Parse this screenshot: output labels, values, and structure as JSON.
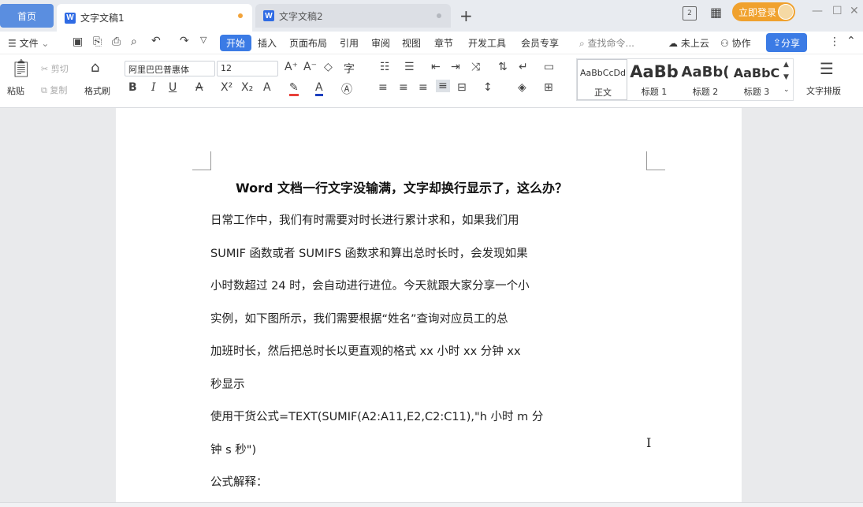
{
  "titlebar": {
    "home_tab": "首页",
    "tabs": [
      {
        "label": "文字文稿1",
        "icon": "W"
      },
      {
        "label": "文字文稿2",
        "icon": "W"
      }
    ],
    "add_tab": "+",
    "login_label": "立即登录",
    "window_controls": {
      "minimize": "—",
      "maximize": "☐",
      "close": "✕"
    }
  },
  "menubar": {
    "file": "文件",
    "items": [
      "开始",
      "插入",
      "页面布局",
      "引用",
      "审阅",
      "视图",
      "章节",
      "开发工具",
      "会员专享"
    ],
    "search_placeholder": "查找命令...",
    "cloud": "未上云",
    "collab": "协作",
    "share": "分享"
  },
  "ribbon": {
    "paste": "粘贴",
    "cut": "剪切",
    "copy": "复制",
    "format_painter": "格式刷",
    "font_name": "阿里巴巴普惠体",
    "font_size": "12",
    "bold": "B",
    "italic": "I",
    "underline": "U",
    "styles": [
      {
        "sample": "AaBbCcDd",
        "label": "正文"
      },
      {
        "sample": "AaBb",
        "label": "标题 1"
      },
      {
        "sample": "AaBb(",
        "label": "标题 2"
      },
      {
        "sample": "AaBbC",
        "label": "标题 3"
      }
    ],
    "text_layout": "文字排版"
  },
  "document": {
    "title": "Word 文档一行文字没输满，文字却换行显示了，这么办？",
    "lines": [
      "日常工作中，我们有时需要对时长进行累计求和，如果我们用",
      "SUMIF 函数或者 SUMIFS 函数求和算出总时长时，会发现如果",
      "小时数超过 24 时，会自动进行进位。今天就跟大家分享一个小",
      "实例，如下图所示，我们需要根据“姓名”查询对应员工的总",
      "加班时长，然后把总时长以更直观的格式 xx 小时 xx 分钟 xx",
      "秒显示",
      "使用干货公式=TEXT(SUMIF(A2:A11,E2,C2:C11),\"h 小时 m 分",
      "钟 s 秒\")",
      "公式解释："
    ]
  },
  "colors": {
    "accent": "#3b7be5",
    "home_tab": "#5a8ee0",
    "login": "#f0a12d"
  }
}
